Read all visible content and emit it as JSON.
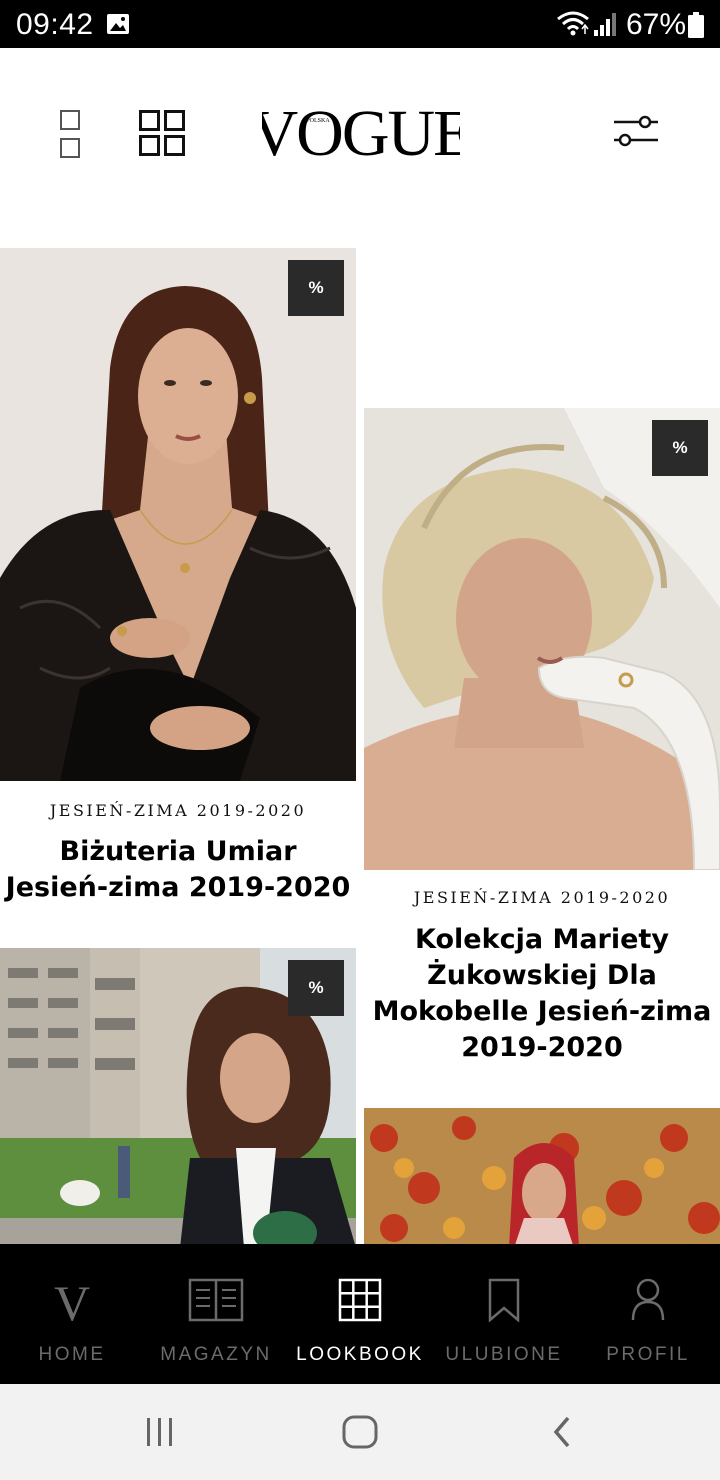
{
  "status_bar": {
    "time": "09:42",
    "battery": "67%",
    "icons": [
      "photo-icon",
      "wifi-icon",
      "signal-icon",
      "battery-icon"
    ]
  },
  "top_bar": {
    "logo_text": "VOGUE",
    "logo_sub": "POLSKA",
    "icons": [
      "view-single-icon",
      "view-grid-icon",
      "filter-icon"
    ]
  },
  "feed": {
    "cards": [
      {
        "badge": "%",
        "category": "JESIEŃ-ZIMA 2019-2020",
        "title_lines": [
          "Biżuteria Umiar",
          "Jesień-zima 2019-2020"
        ]
      },
      {
        "badge": "%",
        "category": "JESIEŃ-ZIMA 2019-2020",
        "title_lines": [
          "Kolekcja Mariety",
          "Żukowskiej Dla",
          "Mokobelle Jesień-zima",
          "2019-2020"
        ]
      },
      {
        "badge": "%"
      },
      {}
    ]
  },
  "bottom_nav": {
    "items": [
      {
        "label": "HOME",
        "icon": "vogue-v-icon",
        "active": false
      },
      {
        "label": "MAGAZYN",
        "icon": "magazine-icon",
        "active": false
      },
      {
        "label": "LOOKBOOK",
        "icon": "grid-icon",
        "active": true
      },
      {
        "label": "ULUBIONE",
        "icon": "bookmark-icon",
        "active": false
      },
      {
        "label": "PROFIL",
        "icon": "user-icon",
        "active": false
      }
    ]
  },
  "system_nav": {
    "icons": [
      "recent-apps-icon",
      "home-icon",
      "back-icon"
    ]
  },
  "colors": {
    "status_bg": "#000000",
    "nav_bg": "#000000",
    "nav_active": "#ffffff",
    "nav_inactive": "#6b6b6b",
    "badge_bg": "#2a2a2a"
  }
}
